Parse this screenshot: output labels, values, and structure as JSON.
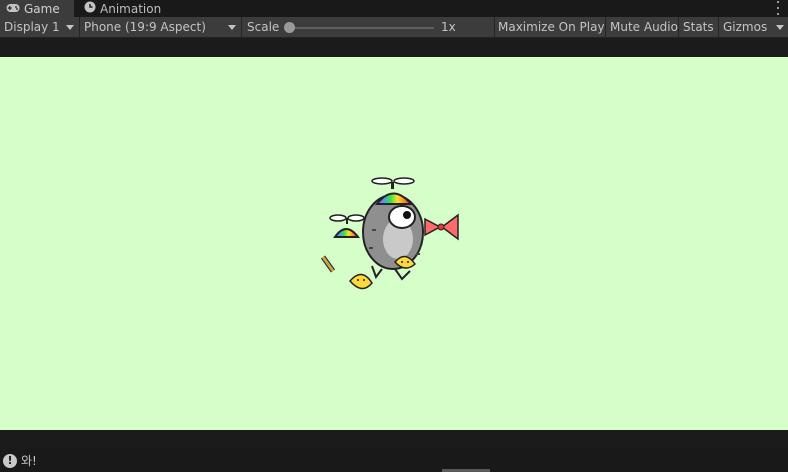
{
  "tabs": [
    {
      "label": "Game",
      "icon": "gamepad-icon",
      "active": true
    },
    {
      "label": "Animation",
      "icon": "clock-icon",
      "active": false
    }
  ],
  "toolbar": {
    "display": "Display 1",
    "aspect": "Phone (19:9 Aspect)",
    "scale_label": "Scale",
    "scale_value": "1x",
    "maximize": "Maximize On Play",
    "mute": "Mute Audio",
    "stats": "Stats",
    "gizmos": "Gizmos"
  },
  "status": {
    "message": "와!"
  },
  "colors": {
    "game_background": "#d5fec9",
    "editor_dark": "#191919",
    "toolbar": "#3c3c3c"
  }
}
